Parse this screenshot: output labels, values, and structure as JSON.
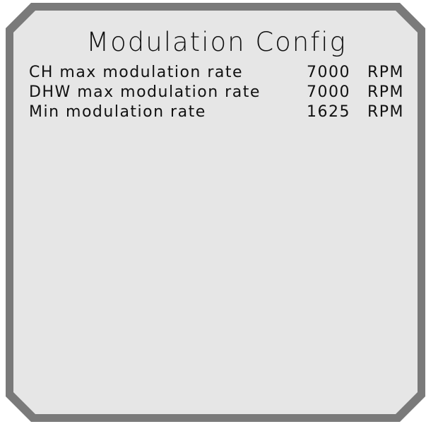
{
  "screen": {
    "title": "Modulation Config",
    "colors": {
      "frame": "#7a7a7a",
      "panel": "#e6e6e6",
      "text": "#111111"
    }
  },
  "rows": [
    {
      "label": "CH max modulation rate",
      "value": "7000",
      "unit": "RPM"
    },
    {
      "label": "DHW max modulation rate",
      "value": "7000",
      "unit": "RPM"
    },
    {
      "label": "Min modulation rate",
      "value": "1625",
      "unit": "RPM"
    }
  ]
}
